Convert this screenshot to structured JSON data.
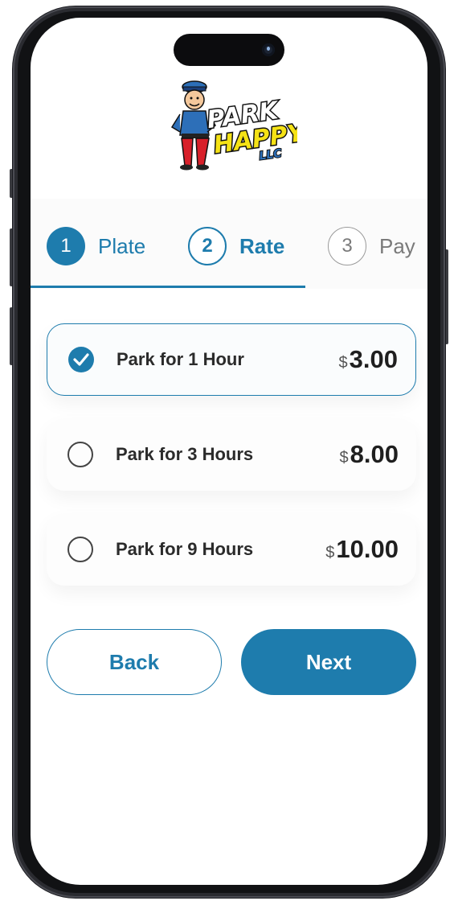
{
  "brand": {
    "logo_line1": "PARK",
    "logo_line2": "HAPPY",
    "logo_line3": "LLC",
    "accent_color": "#1e7cad"
  },
  "stepper": {
    "steps": [
      {
        "number": "1",
        "label": "Plate",
        "state": "completed"
      },
      {
        "number": "2",
        "label": "Rate",
        "state": "active"
      },
      {
        "number": "3",
        "label": "Pay",
        "state": "pending"
      }
    ]
  },
  "rates": [
    {
      "label": "Park for 1 Hour",
      "currency": "$",
      "amount": "3.00",
      "selected": true
    },
    {
      "label": "Park for 3 Hours",
      "currency": "$",
      "amount": "8.00",
      "selected": false
    },
    {
      "label": "Park for 9 Hours",
      "currency": "$",
      "amount": "10.00",
      "selected": false
    }
  ],
  "actions": {
    "back_label": "Back",
    "next_label": "Next"
  }
}
